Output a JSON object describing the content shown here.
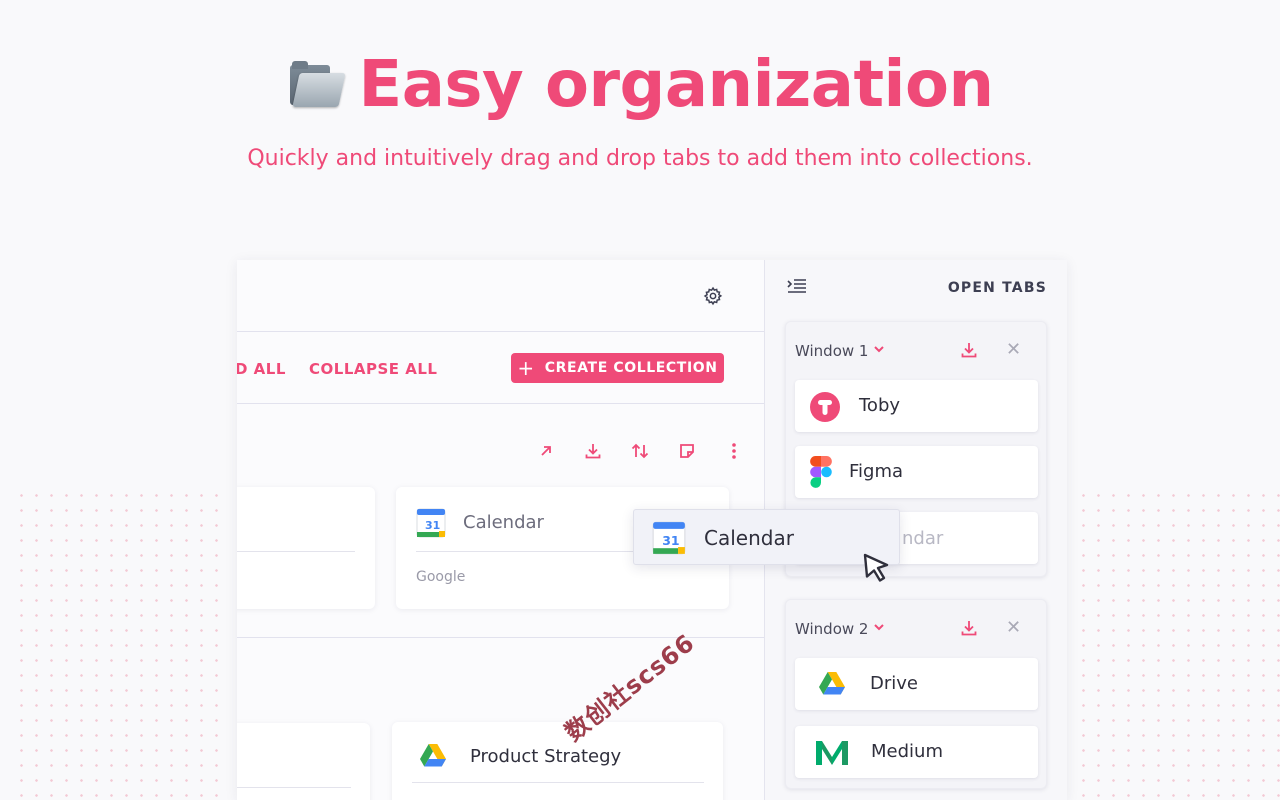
{
  "hero": {
    "icon": "folder-icon",
    "title": "Easy organization",
    "subtitle": "Quickly and intuitively drag and drop tabs to add them into collections."
  },
  "toolbar": {
    "expand_all_partial": "D ALL",
    "collapse_all": "COLLAPSE ALL",
    "create_collection": "CREATE COLLECTION"
  },
  "collection_actions": [
    "open-in-new-icon",
    "download-icon",
    "sort-icon",
    "note-icon",
    "more-vert-icon"
  ],
  "cards": [
    {
      "title": "Calendar",
      "meta": "Google",
      "icon": "google-calendar-icon"
    },
    {
      "title": "Product Strategy",
      "icon": "google-drive-icon"
    }
  ],
  "side_panel": {
    "title": "OPEN TABS",
    "windows": [
      {
        "name": "Window 1",
        "tabs": [
          {
            "label": "Toby",
            "icon": "toby-icon"
          },
          {
            "label": "Figma",
            "icon": "figma-icon"
          },
          {
            "label": "ndar",
            "ghost": true
          }
        ]
      },
      {
        "name": "Window 2",
        "tabs": [
          {
            "label": "Drive",
            "icon": "google-drive-icon"
          },
          {
            "label": "Medium",
            "icon": "medium-icon"
          }
        ]
      }
    ]
  },
  "drag_item": {
    "label": "Calendar",
    "icon": "google-calendar-icon",
    "calendar_day": "31"
  },
  "watermark": "数创社scs66",
  "colors": {
    "accent": "#ef4a78",
    "panel_bg": "#fbfbfd",
    "side_bg": "#f7f7fa"
  }
}
